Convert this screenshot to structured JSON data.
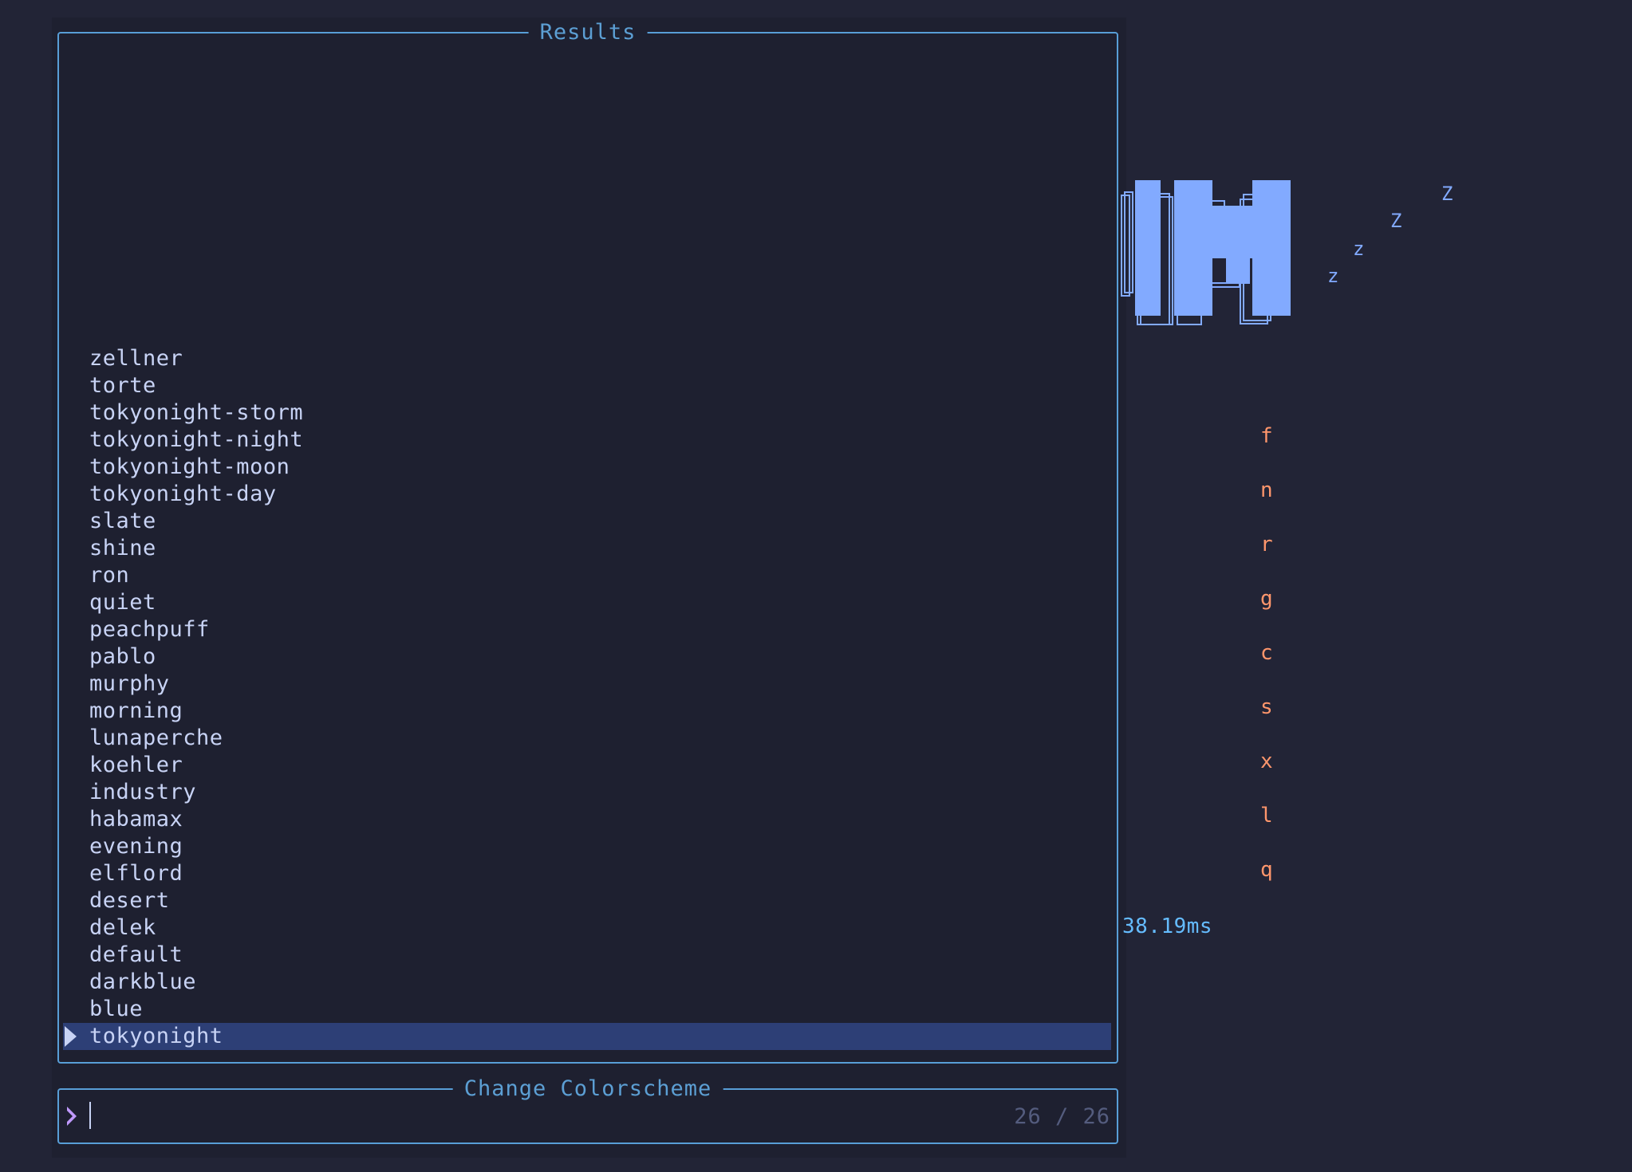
{
  "results": {
    "title": "Results",
    "items": [
      "zellner",
      "torte",
      "tokyonight-storm",
      "tokyonight-night",
      "tokyonight-moon",
      "tokyonight-day",
      "slate",
      "shine",
      "ron",
      "quiet",
      "peachpuff",
      "pablo",
      "murphy",
      "morning",
      "lunaperche",
      "koehler",
      "industry",
      "habamax",
      "evening",
      "elflord",
      "desert",
      "delek",
      "default",
      "darkblue",
      "blue",
      "tokyonight"
    ],
    "selected": "tokyonight"
  },
  "prompt": {
    "title": "Change Colorscheme",
    "value": "",
    "prefix_icon": "prompt-chevron-icon",
    "counter": "26 / 26"
  },
  "dashboard": {
    "logo_icon": "neovim-sleeping-logo-icon",
    "sleep_letters": [
      "z",
      "z",
      "Z",
      "Z"
    ],
    "keys": [
      "f",
      "n",
      "r",
      "g",
      "c",
      "s",
      "x",
      "l",
      "q"
    ],
    "startup_time": "38.19ms"
  },
  "colors": {
    "background": "#222436",
    "picker_background": "#1e2030",
    "border": "#589ed7",
    "text": "#c8d3f5",
    "selection": "#2d3f76",
    "accent_blue": "#82aaff",
    "key_orange": "#ff966c",
    "prompt_purple": "#c099ff",
    "counter_gray": "#545c7e"
  }
}
